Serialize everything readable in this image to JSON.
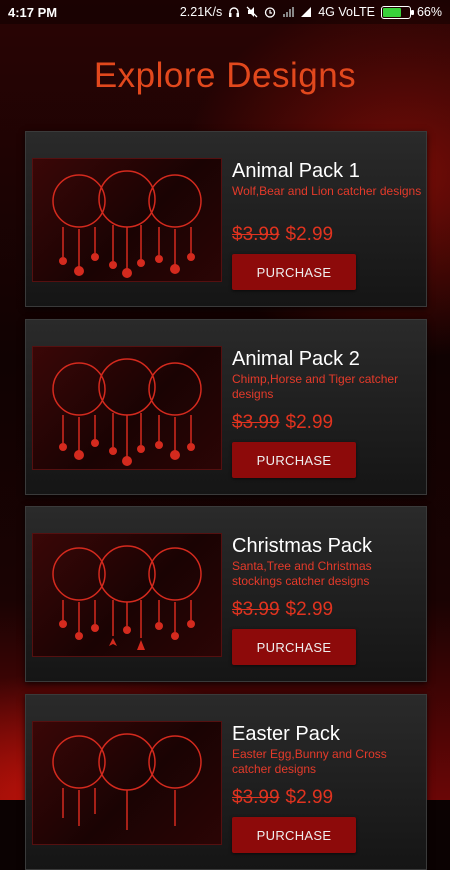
{
  "status": {
    "time": "4:17 PM",
    "speed": "2.21K/s",
    "network": "4G VoLTE",
    "battery": "66%"
  },
  "header": {
    "title": "Explore Designs"
  },
  "packs": [
    {
      "title": "Animal Pack 1",
      "description": "Wolf,Bear and Lion catcher designs",
      "old_price": "$3.99",
      "price": "$2.99",
      "button": "PURCHASE"
    },
    {
      "title": "Animal Pack 2",
      "description": "Chimp,Horse and Tiger catcher designs",
      "old_price": "$3.99",
      "price": "$2.99",
      "button": "PURCHASE"
    },
    {
      "title": "Christmas Pack",
      "description": "Santa,Tree and Christmas stockings catcher designs",
      "old_price": "$3.99",
      "price": "$2.99",
      "button": "PURCHASE"
    },
    {
      "title": "Easter Pack",
      "description": "Easter Egg,Bunny and Cross catcher designs",
      "old_price": "$3.99",
      "price": "$2.99",
      "button": "PURCHASE"
    }
  ],
  "colors": {
    "accent": "#e2481d",
    "price": "#e0331f",
    "button": "#8d0a0a"
  }
}
